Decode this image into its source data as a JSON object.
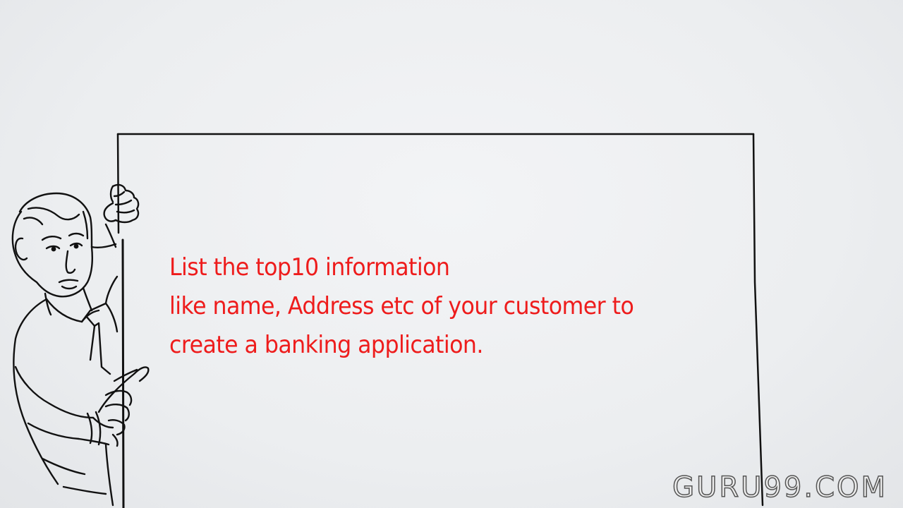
{
  "board": {
    "lines": [
      "List the top10 information",
      "like name, Address etc of your customer to",
      "create a banking application."
    ]
  },
  "watermark": {
    "text": "GURU99.COM"
  },
  "colors": {
    "text": "#ee1c1c",
    "stroke": "#111111",
    "background": "#eceef0"
  },
  "icons": {
    "presenter": "man-pointing-illustration"
  }
}
